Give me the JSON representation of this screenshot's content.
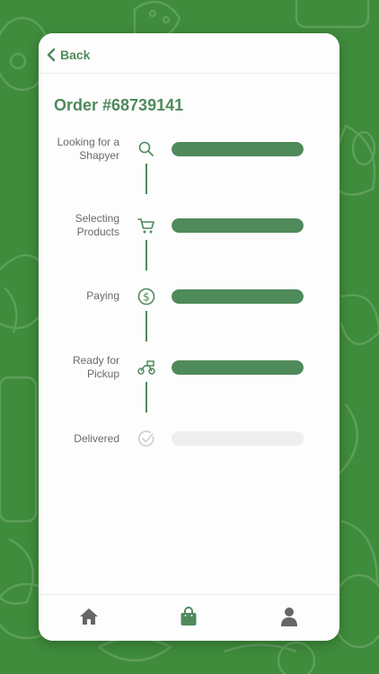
{
  "header": {
    "back_label": "Back"
  },
  "order": {
    "title": "Order #68739141"
  },
  "steps": [
    {
      "label_line1": "Looking for a",
      "label_line2": "Shapyer",
      "icon": "search-icon",
      "progress": 1.0
    },
    {
      "label_line1": "Selecting",
      "label_line2": "Products",
      "icon": "cart-icon",
      "progress": 1.0
    },
    {
      "label_line1": "Paying",
      "label_line2": "",
      "icon": "dollar-icon",
      "progress": 1.0
    },
    {
      "label_line1": "Ready for",
      "label_line2": "Pickup",
      "icon": "delivery-bike-icon",
      "progress": 1.0
    },
    {
      "label_line1": "Delivered",
      "label_line2": "",
      "icon": "check-circle-icon",
      "progress": 0.0
    }
  ],
  "bottom_nav": {
    "items": [
      {
        "icon": "home-icon",
        "active": false
      },
      {
        "icon": "shopping-bag-icon",
        "active": true
      },
      {
        "icon": "user-icon",
        "active": false
      }
    ]
  },
  "colors": {
    "background": "#3f8c3c",
    "accent": "#4f8a5b",
    "inactive_bar": "#eeeeee",
    "nav_inactive": "#666666"
  }
}
